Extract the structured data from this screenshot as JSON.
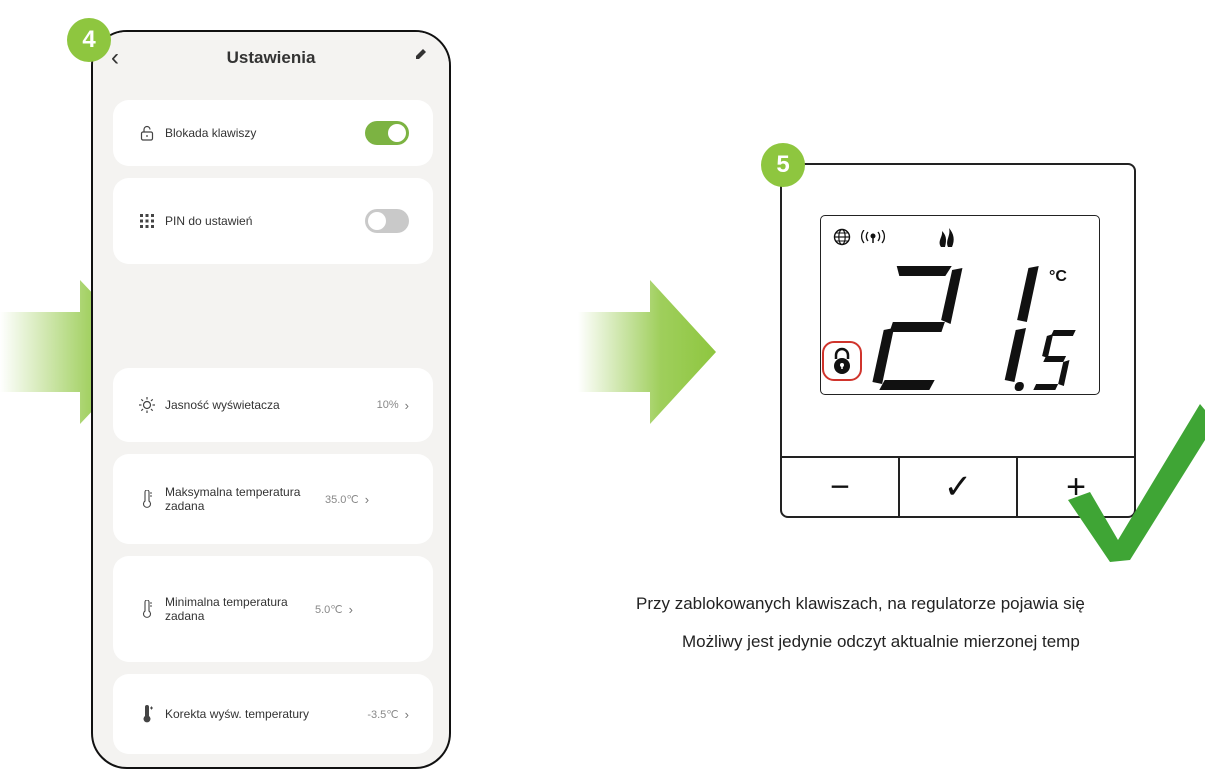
{
  "steps": {
    "phone_step": "4",
    "thermostat_step": "5"
  },
  "phone": {
    "title": "Ustawienia",
    "items": [
      {
        "label": "Blokada klawiszy",
        "icon": "lock-icon",
        "toggle": true
      },
      {
        "label": "PIN do ustawień",
        "icon": "keypad-icon",
        "toggle": false
      },
      {
        "label": "Jasność wyświetacza",
        "icon": "brightness-icon",
        "value": "10%"
      },
      {
        "label": "Maksymalna temperatura zadana",
        "icon": "thermometer-icon",
        "value": "35.0℃"
      },
      {
        "label": "Minimalna temperatura zadana",
        "icon": "thermometer-icon",
        "value": "5.0℃"
      },
      {
        "label": "Korekta wyśw. temperatury",
        "icon": "thermometer-correction-icon",
        "value": "-3.5℃"
      }
    ]
  },
  "thermostat": {
    "temperature": "21.5",
    "unit": "°C",
    "buttons": {
      "minus": "−",
      "confirm": "✓",
      "plus": "+"
    },
    "indicators": [
      "globe-icon",
      "wifi-signal-icon",
      "flame-icon",
      "lock-icon"
    ]
  },
  "caption": {
    "line1": "Przy zablokowanych klawiszach, na regulatorze pojawia się",
    "line2": "Możliwy jest jedynie odczyt aktualnie mierzonej temp"
  },
  "colors": {
    "accent_green": "#8ec63f",
    "toggle_on": "#7cb342",
    "check_green": "#3fa535",
    "lock_highlight": "#d0342c"
  }
}
